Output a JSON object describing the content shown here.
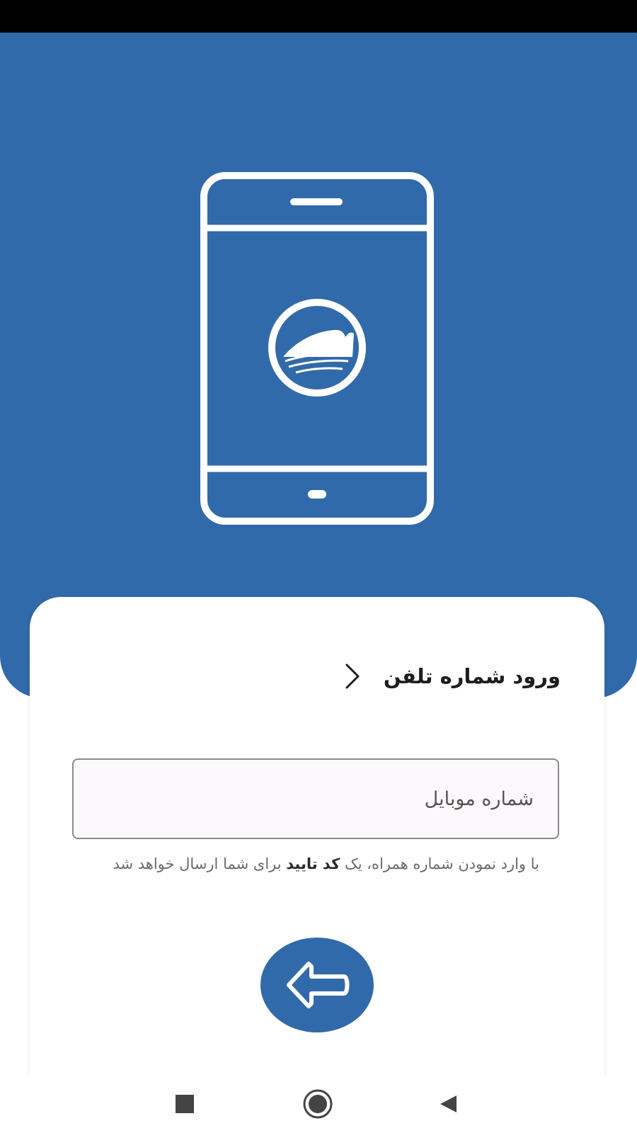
{
  "colors": {
    "primary": "#316aaa",
    "status_bar": "#000000",
    "card_background": "#ffffff",
    "title_text": "#1d1d1f",
    "helper_text": "#6a6a6e",
    "field_background": "#fcf9fc"
  },
  "header": {
    "title": "ورود شماره تلفن",
    "back_icon": "chevron-right-icon"
  },
  "hero": {
    "illustration_icon": "smartphone-icon",
    "logo_icon": "wave-circle-logo-icon"
  },
  "form": {
    "mobile_placeholder": "شماره موبایل",
    "mobile_value": "",
    "helper_before": "با وارد نمودن شماره همراه، یک ",
    "helper_bold": "کد تایید",
    "helper_after": " برای شما ارسال خواهد شد",
    "submit_icon": "arrow-left-icon"
  },
  "nav_bar": {
    "recent_icon": "square-icon",
    "home_icon": "circle-home-icon",
    "back_icon": "triangle-back-icon"
  }
}
